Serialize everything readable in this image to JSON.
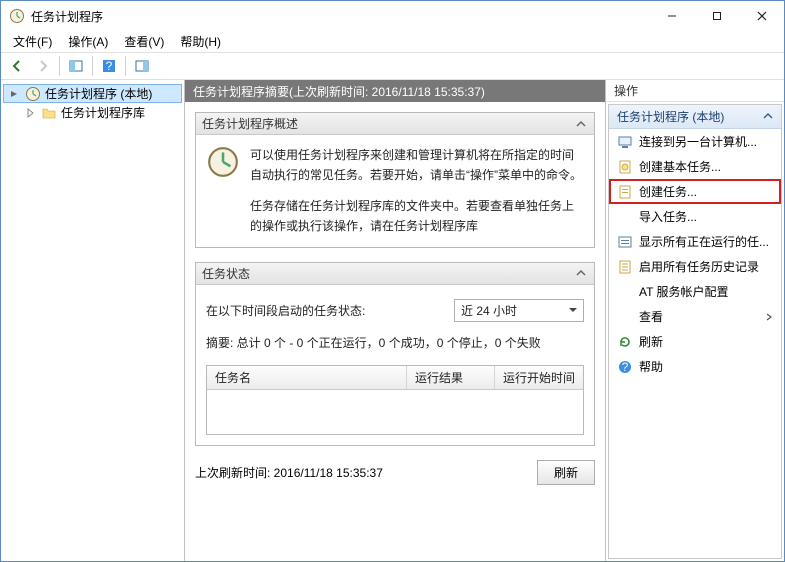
{
  "window": {
    "title": "任务计划程序"
  },
  "menu": {
    "file": "文件(F)",
    "action": "操作(A)",
    "view": "查看(V)",
    "help": "帮助(H)"
  },
  "tree": {
    "root": "任务计划程序 (本地)",
    "library": "任务计划程序库"
  },
  "center": {
    "header": "任务计划程序摘要(上次刷新时间: 2016/11/18 15:35:37)",
    "overview": {
      "title": "任务计划程序概述",
      "para1": "可以使用任务计划程序来创建和管理计算机将在所指定的时间自动执行的常见任务。若要开始，请单击“操作”菜单中的命令。",
      "para2": "任务存储在任务计划程序库的文件夹中。若要查看单独任务上的操作或执行该操作，请在任务计划程序库"
    },
    "status": {
      "title": "任务状态",
      "label": "在以下时间段启动的任务状态:",
      "dropdown": "近 24 小时",
      "summary": "摘要: 总计 0 个 - 0 个正在运行，0 个成功，0 个停止，0 个失败",
      "columns": {
        "name": "任务名",
        "result": "运行结果",
        "start": "运行开始时间"
      }
    },
    "footer": {
      "label": "上次刷新时间: 2016/11/18 15:35:37",
      "refresh_btn": "刷新"
    }
  },
  "actions": {
    "title": "操作",
    "section": "任务计划程序 (本地)",
    "items": [
      {
        "label": "连接到另一台计算机..."
      },
      {
        "label": "创建基本任务..."
      },
      {
        "label": "创建任务...",
        "highlighted": true
      },
      {
        "label": "导入任务..."
      },
      {
        "label": "显示所有正在运行的任..."
      },
      {
        "label": "启用所有任务历史记录"
      },
      {
        "label": "AT 服务帐户配置"
      },
      {
        "label": "查看",
        "has_submenu": true
      },
      {
        "label": "刷新"
      },
      {
        "label": "帮助"
      }
    ]
  }
}
